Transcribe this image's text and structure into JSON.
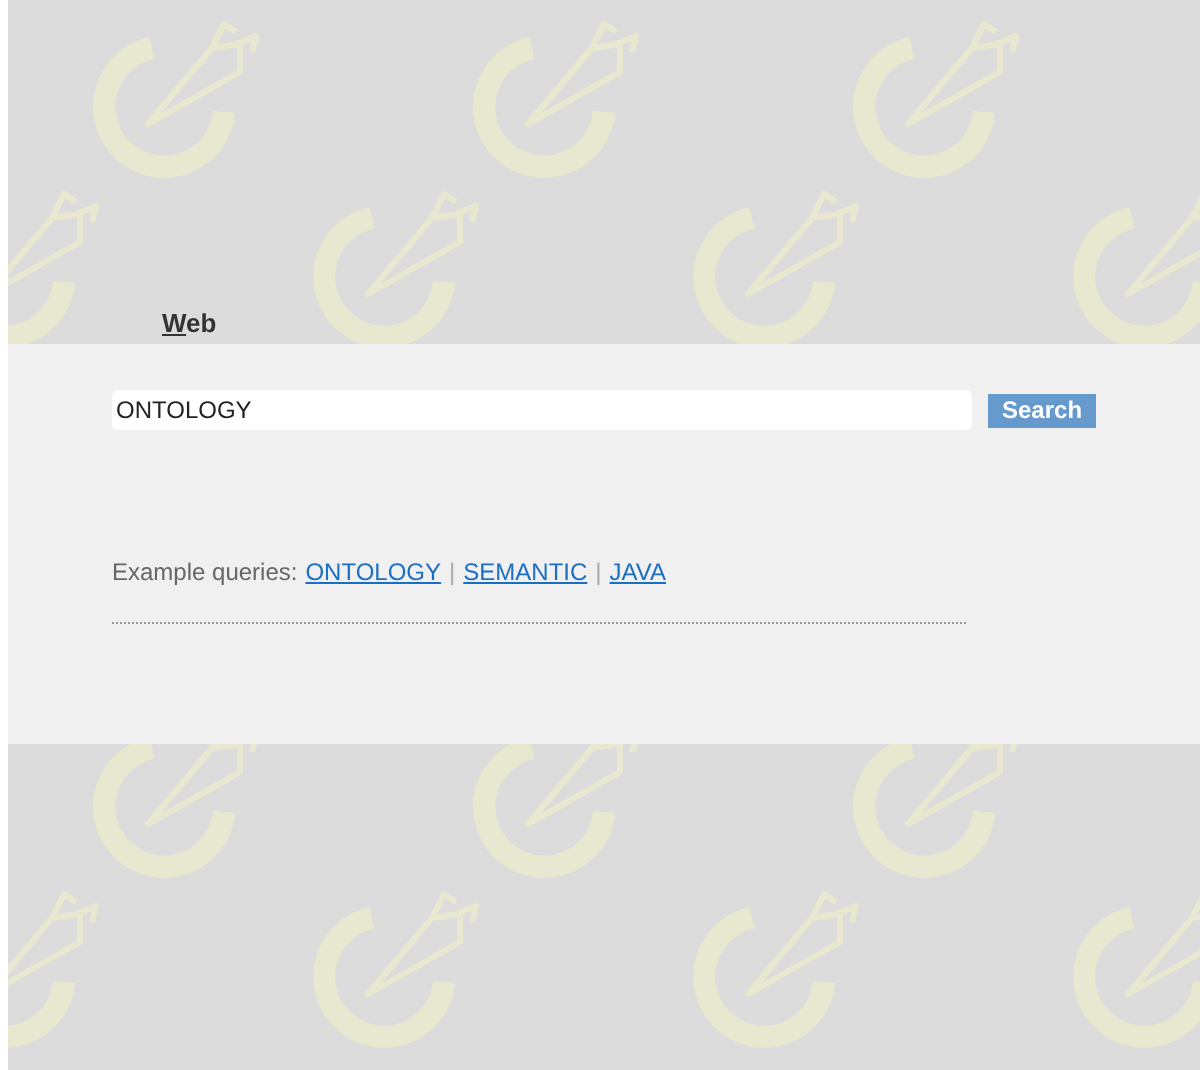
{
  "tabs": [
    {
      "label": "Web",
      "selected": true
    }
  ],
  "search": {
    "value": "ONTOLOGY",
    "button": "Search"
  },
  "examples": {
    "label": "Example queries:",
    "links": [
      "ONTOLOGY",
      "SEMANTIC",
      "JAVA"
    ],
    "separator": "|"
  }
}
